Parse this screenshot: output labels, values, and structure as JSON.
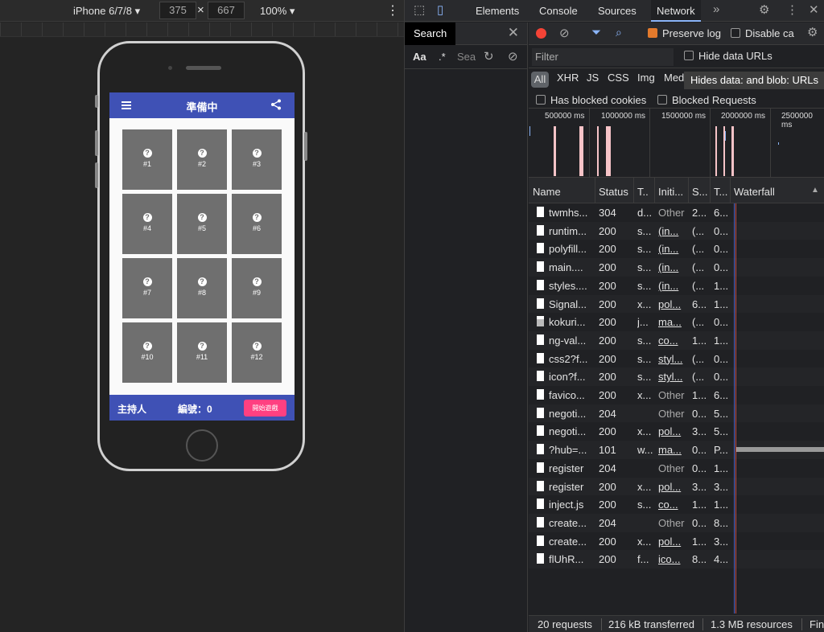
{
  "device_toolbar": {
    "device": "iPhone 6/7/8",
    "width": "375",
    "height": "667",
    "zoom": "100%"
  },
  "app": {
    "title": "準備中",
    "tiles": [
      "#1",
      "#2",
      "#3",
      "#4",
      "#5",
      "#6",
      "#7",
      "#8",
      "#9",
      "#10",
      "#11",
      "#12"
    ],
    "host_label": "主持人",
    "number_label": "編號：0",
    "start_button": "開始遊戲"
  },
  "devtools": {
    "tabs": [
      "Elements",
      "Console",
      "Sources",
      "Network"
    ],
    "active_tab": "Network",
    "search": {
      "title": "Search",
      "aa": "Aa",
      "regex": ".*",
      "placeholder": "Sea"
    },
    "toolbar": {
      "preserve_log": "Preserve log",
      "disable_cache": "Disable ca"
    },
    "filter": {
      "placeholder": "Filter",
      "hide_data_urls": "Hide data URLs"
    },
    "types": [
      "All",
      "XHR",
      "JS",
      "CSS",
      "Img",
      "Med"
    ],
    "tooltip": "Hides data: and blob: URLs",
    "blocked_cookies": "Has blocked cookies",
    "blocked_requests": "Blocked Requests",
    "timeline_labels": [
      "500000 ms",
      "1000000 ms",
      "1500000 ms",
      "2000000 ms",
      "2500000 ms"
    ],
    "columns": [
      "Name",
      "Status",
      "T..",
      "Initi...",
      "S...",
      "T...",
      "Waterfall"
    ],
    "rows": [
      {
        "name": "twmhs...",
        "status": "304",
        "type": "d...",
        "init": "Other",
        "size": "2...",
        "time": "6..."
      },
      {
        "name": "runtim...",
        "status": "200",
        "type": "s...",
        "init": "(in...",
        "size": "(...",
        "time": "0..."
      },
      {
        "name": "polyfill...",
        "status": "200",
        "type": "s...",
        "init": "(in...",
        "size": "(...",
        "time": "0..."
      },
      {
        "name": "main....",
        "status": "200",
        "type": "s...",
        "init": "(in...",
        "size": "(...",
        "time": "0..."
      },
      {
        "name": "styles....",
        "status": "200",
        "type": "s...",
        "init": "(in...",
        "size": "(...",
        "time": "1..."
      },
      {
        "name": "Signal...",
        "status": "200",
        "type": "x...",
        "init": "pol...",
        "size": "6...",
        "time": "1..."
      },
      {
        "name": "kokuri...",
        "status": "200",
        "type": "j...",
        "init": "ma...",
        "size": "(...",
        "time": "0..."
      },
      {
        "name": "ng-val...",
        "status": "200",
        "type": "s...",
        "init": "co...",
        "size": "1...",
        "time": "1..."
      },
      {
        "name": "css2?f...",
        "status": "200",
        "type": "s...",
        "init": "styl...",
        "size": "(...",
        "time": "0..."
      },
      {
        "name": "icon?f...",
        "status": "200",
        "type": "s...",
        "init": "styl...",
        "size": "(...",
        "time": "0..."
      },
      {
        "name": "favico...",
        "status": "200",
        "type": "x...",
        "init": "Other",
        "size": "1...",
        "time": "6..."
      },
      {
        "name": "negoti...",
        "status": "204",
        "type": "",
        "init": "Other",
        "size": "0...",
        "time": "5..."
      },
      {
        "name": "negoti...",
        "status": "200",
        "type": "x...",
        "init": "pol...",
        "size": "3...",
        "time": "5..."
      },
      {
        "name": "?hub=...",
        "status": "101",
        "type": "w...",
        "init": "ma...",
        "size": "0...",
        "time": "P..."
      },
      {
        "name": "register",
        "status": "204",
        "type": "",
        "init": "Other",
        "size": "0...",
        "time": "1..."
      },
      {
        "name": "register",
        "status": "200",
        "type": "x...",
        "init": "pol...",
        "size": "3...",
        "time": "3..."
      },
      {
        "name": "inject.js",
        "status": "200",
        "type": "s...",
        "init": "co...",
        "size": "1...",
        "time": "1..."
      },
      {
        "name": "create...",
        "status": "204",
        "type": "",
        "init": "Other",
        "size": "0...",
        "time": "8..."
      },
      {
        "name": "create...",
        "status": "200",
        "type": "x...",
        "init": "pol...",
        "size": "1...",
        "time": "3..."
      },
      {
        "name": "flUhR...",
        "status": "200",
        "type": "f...",
        "init": "ico...",
        "size": "8...",
        "time": "4..."
      }
    ],
    "status_bar": {
      "requests": "20 requests",
      "transferred": "216 kB transferred",
      "resources": "1.3 MB resources",
      "finish": "Fini"
    }
  }
}
